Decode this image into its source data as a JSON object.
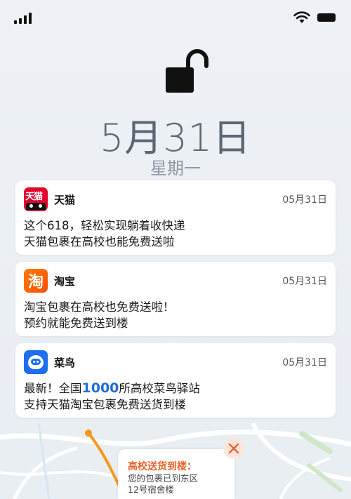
{
  "status_bar": {
    "signal_icon": "cellular-signal-icon",
    "wifi_icon": "wifi-icon",
    "battery_icon": "battery-icon"
  },
  "lock": {
    "icon": "unlocked-padlock-icon"
  },
  "date": "5月31日",
  "weekday": "星期一",
  "notifications": [
    {
      "app": "天猫",
      "icon": "tmall-app-icon",
      "time": "05月31日",
      "lines": [
        "这个618，轻松实现躺着收快递",
        "天猫包裹在高校也能免费送啦"
      ]
    },
    {
      "app": "淘宝",
      "icon": "taobao-app-icon",
      "icon_glyph": "淘",
      "time": "05月31日",
      "lines": [
        "淘宝包裹在高校也免费送啦！",
        "预约就能免费送到楼"
      ]
    },
    {
      "app": "菜鸟",
      "icon": "cainiao-app-icon",
      "time": "05月31日",
      "line1_prefix": "最新！全国",
      "line1_highlight": "1000",
      "line1_suffix": "所高校菜鸟驿站",
      "line2": "支持天猫淘宝包裹免费送货到楼"
    }
  ],
  "tmall_icon_text": "天猫",
  "map_popup": {
    "title": "高校送货到楼：",
    "text_line1": "您的包裹已到东区",
    "text_line2": "12号宿舍楼",
    "close_icon": "close-icon"
  },
  "colors": {
    "accent_orange": "#e8642c",
    "highlight_blue": "#1f6dd6",
    "tmall_red": "#e4002b",
    "taobao_orange": "#ff5a00",
    "cainiao_blue": "#1e6ef0"
  }
}
